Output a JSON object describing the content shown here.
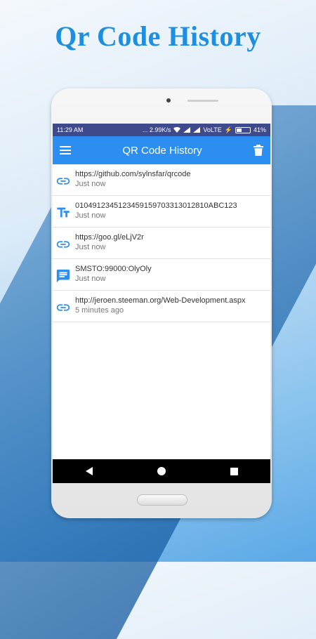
{
  "promo": {
    "title": "Qr Code History"
  },
  "status_bar": {
    "time": "11:29 AM",
    "network_speed": "... 2.99K/s",
    "network_type": "VoLTE",
    "battery": "41%"
  },
  "app_bar": {
    "title": "QR Code History"
  },
  "history": [
    {
      "type": "link-icon",
      "value": "https://github.com/sylnsfar/qrcode",
      "time": "Just now"
    },
    {
      "type": "text-icon",
      "value": "0104912345123459159703313012810ABC123",
      "time": "Just now"
    },
    {
      "type": "link-icon",
      "value": "https://goo.gl/eLjV2r",
      "time": "Just now"
    },
    {
      "type": "sms-icon",
      "value": "SMSTO:99000:OlyOly",
      "time": "Just now"
    },
    {
      "type": "link-icon",
      "value": "http://jeroen.steeman.org/Web-Development.aspx",
      "time": "5 minutes ago"
    }
  ],
  "colors": {
    "accent": "#2b8ef0",
    "status_bar": "#3f4a8c",
    "promo_title": "#1e8fe0"
  }
}
